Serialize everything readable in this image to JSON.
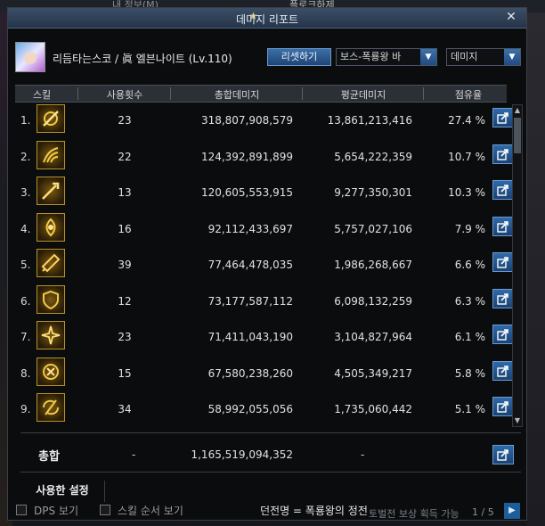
{
  "background": {
    "left_tab": "내 정보(M)",
    "right_tab": "플로크하제",
    "footer_text": "토벌전 보상 획득 가능",
    "page_indicator": "1 / 5"
  },
  "window": {
    "title": "데미지 리포트"
  },
  "header": {
    "character": "리듬타는스코 / 眞 엘븐나이트 (Lv.110)",
    "reset_label": "리셋하기",
    "boss_select": "보스-폭룡왕 바",
    "metric_select": "데미지"
  },
  "columns": {
    "skill": "스킬",
    "count": "사용횟수",
    "total": "총합데미지",
    "avg": "평균데미지",
    "share": "점유율"
  },
  "rows": [
    {
      "rank": "1.",
      "count": "23",
      "total": "318,807,908,579",
      "avg": "13,861,213,416",
      "share": "27.4 %"
    },
    {
      "rank": "2.",
      "count": "22",
      "total": "124,392,891,899",
      "avg": "5,654,222,359",
      "share": "10.7 %"
    },
    {
      "rank": "3.",
      "count": "13",
      "total": "120,605,553,915",
      "avg": "9,277,350,301",
      "share": "10.3 %"
    },
    {
      "rank": "4.",
      "count": "16",
      "total": "92,112,433,697",
      "avg": "5,757,027,106",
      "share": "7.9 %"
    },
    {
      "rank": "5.",
      "count": "39",
      "total": "77,464,478,035",
      "avg": "1,986,268,667",
      "share": "6.6 %"
    },
    {
      "rank": "6.",
      "count": "12",
      "total": "73,177,587,112",
      "avg": "6,098,132,259",
      "share": "6.3 %"
    },
    {
      "rank": "7.",
      "count": "23",
      "total": "71,411,043,190",
      "avg": "3,104,827,964",
      "share": "6.1 %"
    },
    {
      "rank": "8.",
      "count": "15",
      "total": "67,580,238,260",
      "avg": "4,505,349,217",
      "share": "5.8 %"
    },
    {
      "rank": "9.",
      "count": "34",
      "total": "58,992,055,056",
      "avg": "1,735,060,442",
      "share": "5.1 %"
    }
  ],
  "totals": {
    "label": "총합",
    "count": "-",
    "total": "1,165,519,094,352",
    "avg": "-"
  },
  "settings_tab": "사용한 설정",
  "footer": {
    "dps_label": "DPS 보기",
    "skill_order_label": "스킬 순서 보기",
    "status": "던전명 = 폭룡왕의 정전"
  },
  "icons": {
    "skill_icons": [
      "sunburst-slash-icon",
      "claw-rush-icon",
      "spear-thrust-icon",
      "flame-rune-icon",
      "sword-icon",
      "shield-icon",
      "burst-strike-icon",
      "emblem-icon",
      "whirl-strike-icon"
    ],
    "share": "share-export-icon",
    "close": "close-icon",
    "pin": "pin-icon"
  },
  "colors": {
    "accent_blue": "#2f6aa8",
    "skill_gold": "#b8912c"
  }
}
